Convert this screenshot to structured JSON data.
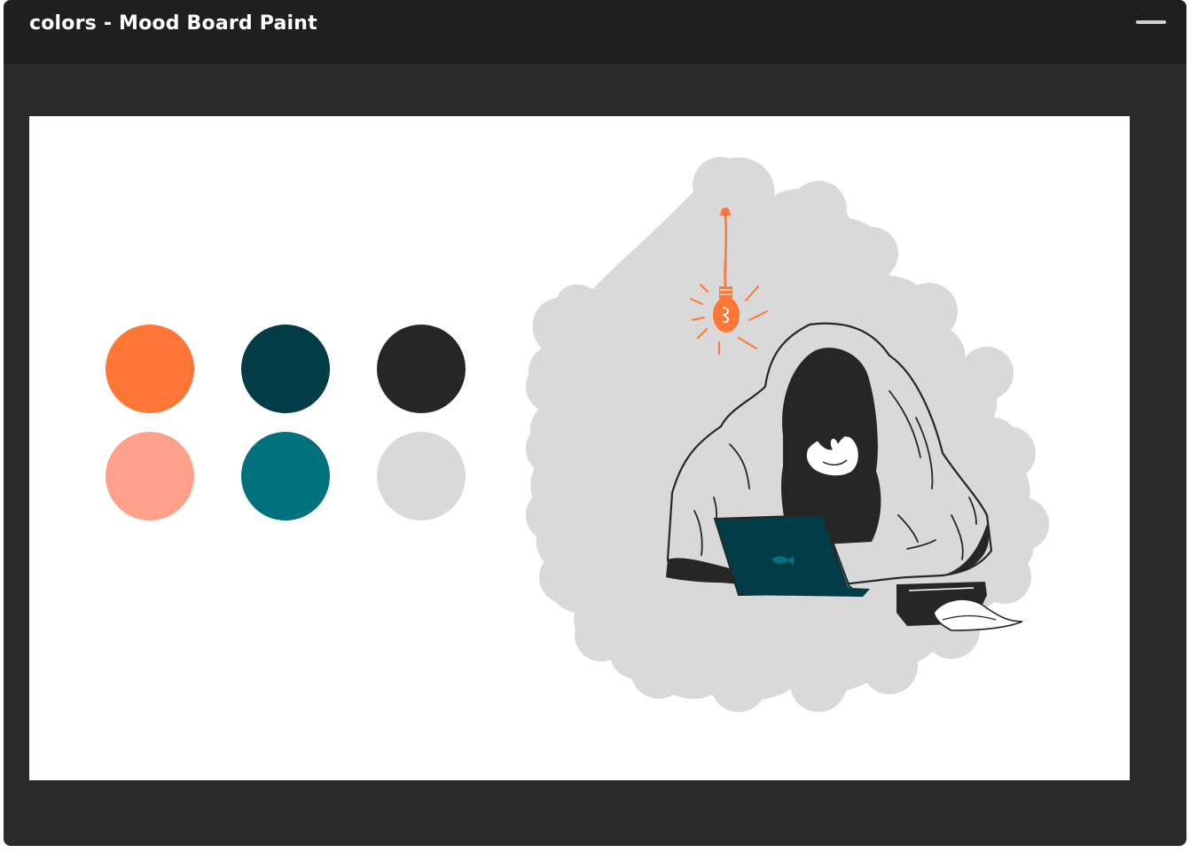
{
  "window": {
    "title": "colors - Mood Board Paint"
  },
  "palette": [
    {
      "name": "orange",
      "color": "#ff7636"
    },
    {
      "name": "dark-teal",
      "color": "#023c47"
    },
    {
      "name": "charcoal",
      "color": "#262626"
    },
    {
      "name": "salmon",
      "color": "#ffa08a"
    },
    {
      "name": "teal",
      "color": "#00717d"
    },
    {
      "name": "light-gray",
      "color": "#d9d9d9"
    }
  ],
  "colors": {
    "titlebar": "#1f1f1f",
    "frame": "#2a2a2a",
    "canvas": "#ffffff",
    "blob": "#d9d9d9",
    "accent": "#ff7636",
    "laptop": "#023c47",
    "ink": "#262626"
  },
  "icons": {
    "minimize": "minimize-icon"
  }
}
